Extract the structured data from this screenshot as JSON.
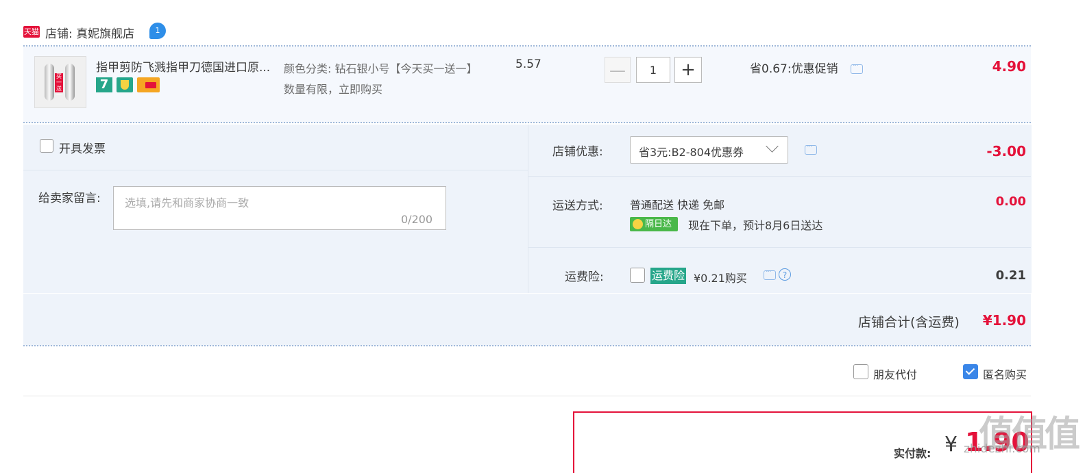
{
  "shop": {
    "badge": "天猫",
    "label": "店铺: 真妮旗舰店",
    "ww_badge": "1"
  },
  "item": {
    "title": "指甲剪防飞溅指甲刀德国进口原...",
    "badge7": "7",
    "sku": "颜色分类: 钻石银小号【今天买一送一】数量有限，立即购买",
    "unit_price": "5.57",
    "qty_minus": "—",
    "qty": "1",
    "qty_plus": "+",
    "promo": "省0.67:优惠促销",
    "total": "4.90"
  },
  "invoice": {
    "label": "开具发票",
    "checked": false
  },
  "memo": {
    "label": "给卖家留言:",
    "placeholder": "选填,请先和商家协商一致",
    "count": "0/200"
  },
  "shop_discount": {
    "label": "店铺优惠:",
    "selected": "省3元:B2-804优惠券",
    "amount": "-3.00"
  },
  "shipping": {
    "label": "运送方式:",
    "method": "普通配送 快递 免邮",
    "nextday_badge": "隔日达",
    "eta": "现在下单，预计8月6日送达",
    "amount": "0.00"
  },
  "insurance": {
    "label": "运费险:",
    "tag": "运费险",
    "price": "¥0.21购买",
    "help": "?",
    "amount": "0.21",
    "checked": false
  },
  "shop_total": {
    "label": "店铺合计(含运费)",
    "amount": "¥1.90"
  },
  "options": {
    "friend_pay": "朋友代付",
    "friend_pay_checked": false,
    "anonymous": "匿名购买",
    "anonymous_checked": true
  },
  "payment": {
    "label": "实付款:",
    "currency": "¥",
    "amount": "1.90"
  },
  "watermark": {
    "main": "值值值",
    "sub": "zhidezhi.com"
  },
  "colors": {
    "accent": "#e4123a",
    "panel": "#eef3fa",
    "green": "#26a68a",
    "checkbox_blue": "#3a86e8"
  }
}
